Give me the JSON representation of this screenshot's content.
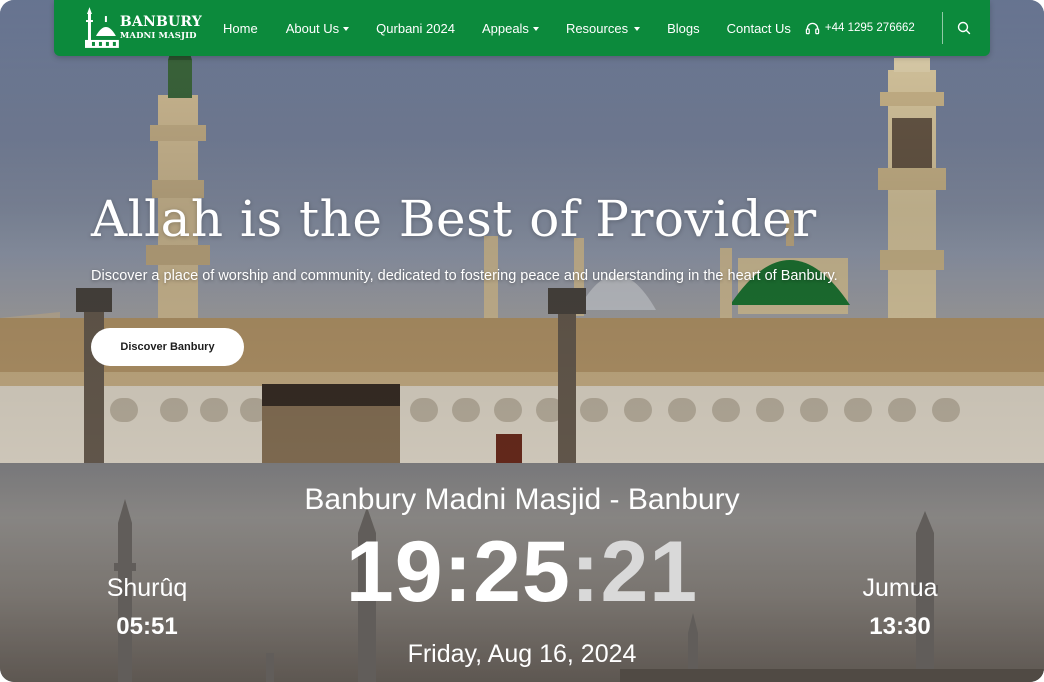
{
  "navbar": {
    "logo_line1": "BANBURY",
    "logo_line2": "MADNI MASJID",
    "items": [
      {
        "label": "Home",
        "dropdown": false
      },
      {
        "label": "About Us",
        "dropdown": true
      },
      {
        "label": "Qurbani 2024",
        "dropdown": false
      },
      {
        "label": "Appeals",
        "dropdown": true
      },
      {
        "label": "Resources",
        "dropdown": true
      },
      {
        "label": "Blogs",
        "dropdown": false
      },
      {
        "label": "Contact Us",
        "dropdown": false
      }
    ],
    "phone": "+44 1295 276662",
    "phone_icon": "headset-icon",
    "search_icon": "search-icon",
    "bg_color": "#0c8a3c"
  },
  "hero": {
    "title": "Allah is the Best of Provider",
    "subtitle": "Discover a place of worship and community, dedicated to fostering peace and understanding in the heart of Banbury.",
    "button_label": "Discover Banbury"
  },
  "prayer": {
    "masjid_name": "Banbury Madni Masjid - Banbury",
    "clock_hm": "19:25",
    "clock_sep": ":",
    "clock_sec": "21",
    "date": "Friday, Aug 16, 2024",
    "left": {
      "name": "Shurûq",
      "time": "05:51"
    },
    "right": {
      "name": "Jumua",
      "time": "13:30"
    }
  }
}
